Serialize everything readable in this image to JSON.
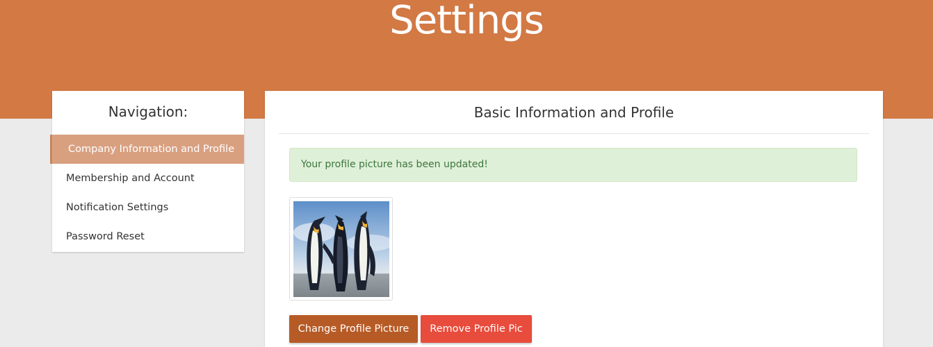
{
  "header": {
    "title": "Settings"
  },
  "navigation": {
    "title": "Navigation:",
    "items": [
      {
        "label": "Company Information and Profile",
        "active": true
      },
      {
        "label": "Membership and Account",
        "active": false
      },
      {
        "label": "Notification Settings",
        "active": false
      },
      {
        "label": "Password Reset",
        "active": false
      }
    ]
  },
  "main": {
    "title": "Basic Information and Profile",
    "alert": "Your profile picture has been updated!",
    "profile_image": {
      "icon": "penguins-photo"
    },
    "buttons": {
      "change": "Change Profile Picture",
      "remove": "Remove Profile Pic"
    }
  },
  "colors": {
    "header_bg": "#d27944",
    "active_nav_bg": "#d9a080",
    "alert_bg": "#dff0d8",
    "alert_text": "#3c763d",
    "change_button": "#b75b26",
    "remove_button": "#e74c3c"
  }
}
